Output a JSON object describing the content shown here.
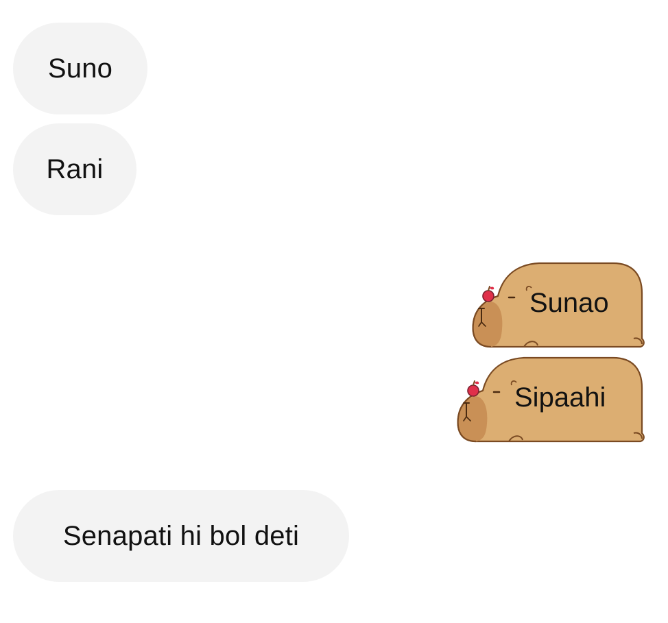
{
  "conversation": {
    "messages": [
      {
        "direction": "incoming",
        "style": "plain",
        "text": "Suno"
      },
      {
        "direction": "incoming",
        "style": "plain",
        "text": "Rani"
      },
      {
        "direction": "outgoing",
        "style": "capybara",
        "text": "Sunao"
      },
      {
        "direction": "outgoing",
        "style": "capybara",
        "text": "Sipaahi"
      },
      {
        "direction": "incoming",
        "style": "plain",
        "text": "Senapati hi bol deti"
      }
    ]
  },
  "theme": {
    "incoming_bubble_color": "#f3f3f3",
    "capybara_body_color": "#dcae72",
    "capybara_face_color": "#c99056",
    "capybara_outline_color": "#7a4a22",
    "apple_color": "#e0304a",
    "capybara_icon": "capybara-icon",
    "apple_icon": "apple-icon"
  }
}
